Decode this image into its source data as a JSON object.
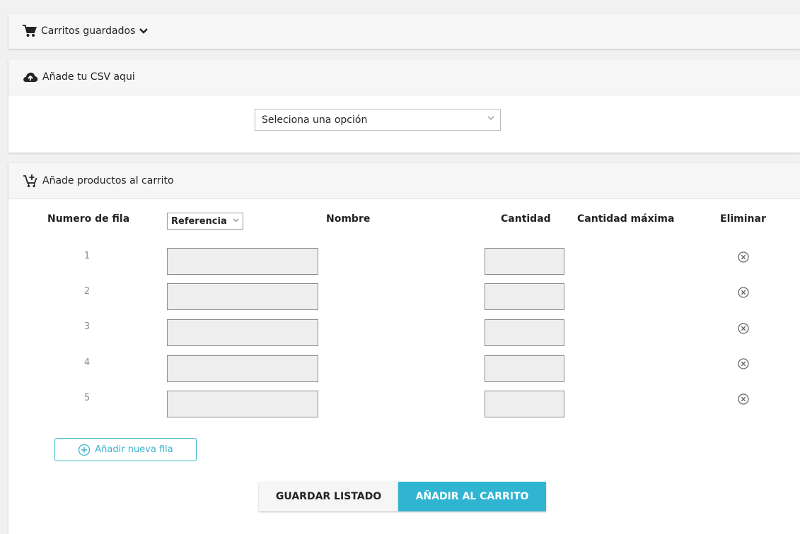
{
  "saved_carts": {
    "title": "Carritos guardados",
    "icon": "shopping-cart-icon"
  },
  "csv_panel": {
    "title": "Añade tu CSV aqui",
    "icon": "cloud-upload-icon",
    "select_value": "Seleciona una opción"
  },
  "products_panel": {
    "title": "Añade productos al carrito",
    "icon": "cart-add-icon",
    "headers": {
      "row_number": "Numero de fila",
      "reference": "Referencia",
      "name": "Nombre",
      "quantity": "Cantidad",
      "max_quantity": "Cantidad máxima",
      "delete": "Eliminar"
    },
    "rows": [
      {
        "num": "1",
        "reference": "",
        "name": "",
        "quantity": "",
        "max_quantity": ""
      },
      {
        "num": "2",
        "reference": "",
        "name": "",
        "quantity": "",
        "max_quantity": ""
      },
      {
        "num": "3",
        "reference": "",
        "name": "",
        "quantity": "",
        "max_quantity": ""
      },
      {
        "num": "4",
        "reference": "",
        "name": "",
        "quantity": "",
        "max_quantity": ""
      },
      {
        "num": "5",
        "reference": "",
        "name": "",
        "quantity": "",
        "max_quantity": ""
      }
    ],
    "add_row_label": "Añadir nueva fila",
    "save_button": "GUARDAR LISTADO",
    "add_to_cart_button": "AÑADIR AL CARRITO"
  },
  "colors": {
    "accent": "#2fb5d2",
    "outline_accent": "#3ab4cc",
    "panel_header": "#f6f6f6",
    "input_bg": "#eeeeee"
  }
}
